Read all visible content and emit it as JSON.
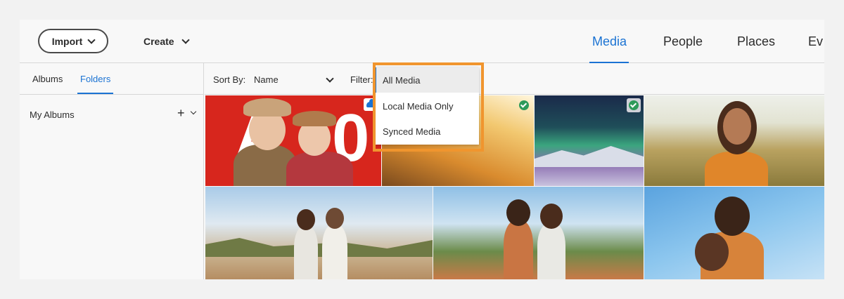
{
  "header": {
    "import_label": "Import",
    "create_label": "Create",
    "tabs": [
      {
        "label": "Media",
        "active": true
      },
      {
        "label": "People",
        "active": false
      },
      {
        "label": "Places",
        "active": false
      },
      {
        "label": "Ev",
        "active": false
      }
    ]
  },
  "sidebar": {
    "tabs": [
      {
        "label": "Albums",
        "active": false
      },
      {
        "label": "Folders",
        "active": true
      }
    ],
    "section_label": "My Albums"
  },
  "toolbar": {
    "sort_label": "Sort By:",
    "sort_value": "Name",
    "filter_label": "Filter:"
  },
  "filter_menu": {
    "selected": "All Media",
    "options": [
      "All Media",
      "Local Media Only",
      "Synced Media"
    ]
  },
  "grid": {
    "tiles": [
      {
        "badge": "cloud-icon"
      },
      {
        "badge": "check-icon"
      },
      {
        "badge": "check-icon"
      },
      {
        "badge": "none"
      },
      {
        "badge": "none"
      },
      {
        "badge": "none"
      },
      {
        "badge": "none"
      }
    ]
  },
  "colors": {
    "accent": "#1b73d3",
    "highlight": "#f0952e",
    "synced_check": "#2e9a5a"
  }
}
